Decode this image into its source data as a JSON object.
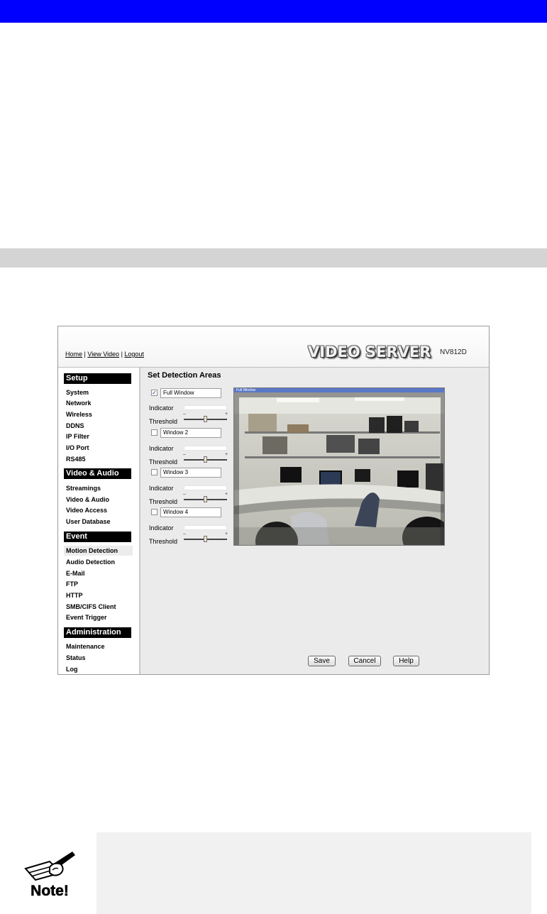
{
  "ui": {
    "nav": {
      "home": "Home",
      "view_video": "View Video",
      "logout": "Logout",
      "sep": " | "
    },
    "brand": "VIDEO SERVER",
    "model": "NV812D",
    "sidebar": {
      "setup": {
        "title": "Setup",
        "items": [
          "System",
          "Network",
          "Wireless",
          "DDNS",
          "IP Filter",
          "I/O Port",
          "RS485"
        ]
      },
      "video_audio": {
        "title": "Video & Audio",
        "items": [
          "Streamings",
          "Video & Audio",
          "Video Access",
          "User Database"
        ]
      },
      "event": {
        "title": "Event",
        "items": [
          "Motion Detection",
          "Audio Detection",
          "E-Mail",
          "FTP",
          "HTTP",
          "SMB/CIFS Client",
          "Event Trigger"
        ]
      },
      "administration": {
        "title": "Administration",
        "items": [
          "Maintenance",
          "Status",
          "Log"
        ]
      },
      "active_item": "Motion Detection"
    },
    "main": {
      "title": "Set Detection Areas",
      "indicator_label": "Indicator",
      "threshold_label": "Threshold",
      "windows": [
        {
          "name": "Full Window",
          "checked": true,
          "threshold": 0.5
        },
        {
          "name": "Window 2",
          "checked": false,
          "threshold": 0.5
        },
        {
          "name": "Window 3",
          "checked": false,
          "threshold": 0.5
        },
        {
          "name": "Window 4",
          "checked": false,
          "threshold": 0.5
        }
      ],
      "video_label": "Full Window"
    },
    "buttons": {
      "save": "Save",
      "cancel": "Cancel",
      "help": "Help"
    }
  },
  "note": {
    "label": "Note!"
  },
  "colors": {
    "top_bar": "#0000ff",
    "gray_band": "#d4d4d4",
    "note_box": "#f1f1f1"
  }
}
